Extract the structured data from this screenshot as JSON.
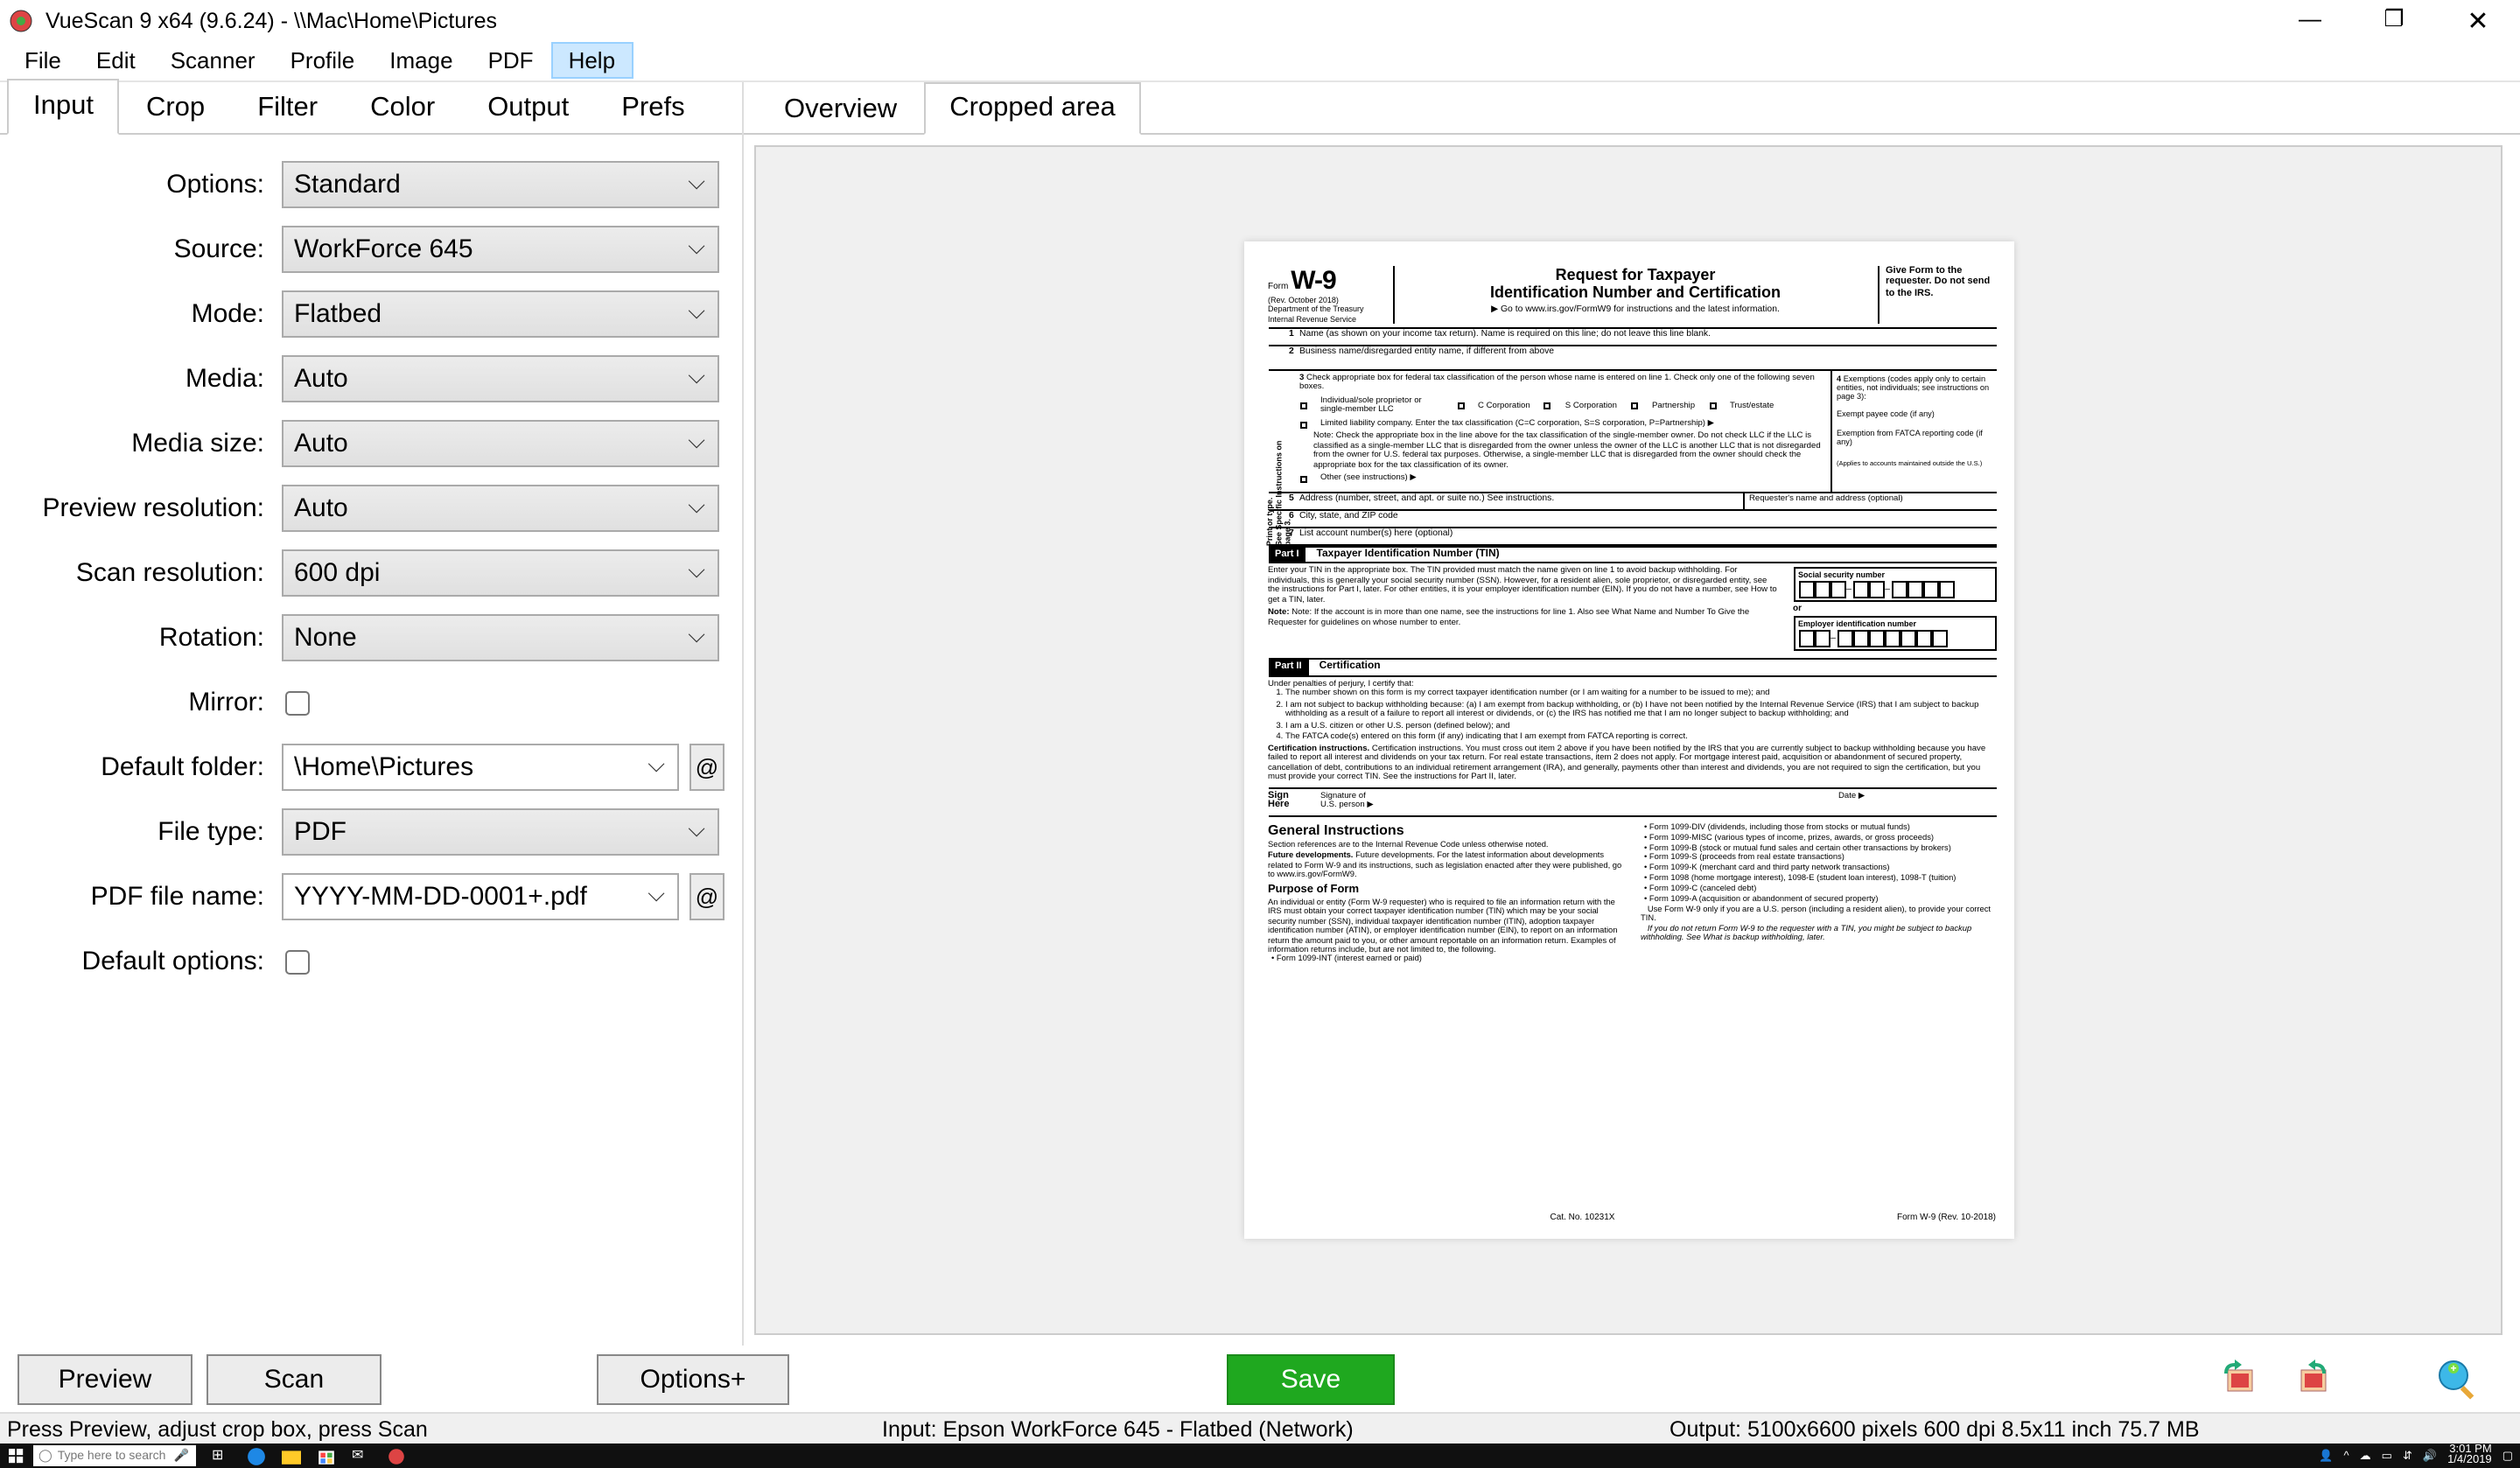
{
  "window": {
    "title": "VueScan 9 x64 (9.6.24)  -  \\\\Mac\\Home\\Pictures"
  },
  "menubar": {
    "items": [
      "File",
      "Edit",
      "Scanner",
      "Profile",
      "Image",
      "PDF",
      "Help"
    ],
    "active_index": 6
  },
  "left_tabs": {
    "items": [
      "Input",
      "Crop",
      "Filter",
      "Color",
      "Output",
      "Prefs"
    ],
    "active_index": 0
  },
  "right_tabs": {
    "items": [
      "Overview",
      "Cropped area"
    ],
    "active_index": 1
  },
  "form": {
    "options": {
      "label": "Options:",
      "value": "Standard"
    },
    "source": {
      "label": "Source:",
      "value": "WorkForce 645"
    },
    "mode": {
      "label": "Mode:",
      "value": "Flatbed"
    },
    "media": {
      "label": "Media:",
      "value": "Auto"
    },
    "media_size": {
      "label": "Media size:",
      "value": "Auto"
    },
    "preview_resolution": {
      "label": "Preview resolution:",
      "value": "Auto"
    },
    "scan_resolution": {
      "label": "Scan resolution:",
      "value": "600 dpi"
    },
    "rotation": {
      "label": "Rotation:",
      "value": "None"
    },
    "mirror": {
      "label": "Mirror:",
      "checked": false
    },
    "default_folder": {
      "label": "Default folder:",
      "value": "\\Home\\Pictures"
    },
    "file_type": {
      "label": "File type:",
      "value": "PDF"
    },
    "pdf_file_name": {
      "label": "PDF file name:",
      "value": "YYYY-MM-DD-0001+.pdf"
    },
    "default_options": {
      "label": "Default options:",
      "checked": false
    }
  },
  "buttons": {
    "preview": "Preview",
    "scan": "Scan",
    "options_plus": "Options+",
    "save": "Save"
  },
  "statusbar": {
    "left": "Press Preview, adjust crop box, press Scan",
    "mid": "Input: Epson WorkForce 645 - Flatbed (Network)",
    "right": "Output: 5100x6600 pixels 600 dpi 8.5x11 inch 75.7 MB"
  },
  "taskbar": {
    "search_placeholder": "Type here to search",
    "time": "3:01 PM",
    "date": "1/4/2019"
  },
  "document": {
    "form_code": "W-9",
    "form_prefix": "Form",
    "rev": "(Rev. October 2018)",
    "dept": "Department of the Treasury\nInternal Revenue Service",
    "title1": "Request for Taxpayer",
    "title2": "Identification Number and Certification",
    "title3": "▶ Go to www.irs.gov/FormW9 for instructions and the latest information.",
    "give_to": "Give Form to the requester. Do not send to the IRS.",
    "row1": "Name (as shown on your income tax return). Name is required on this line; do not leave this line blank.",
    "row2": "Business name/disregarded entity name, if different from above",
    "row3_intro": "Check appropriate box for federal tax classification of the person whose name is entered on line 1. Check only one of the following seven boxes.",
    "row3_checks": [
      "Individual/sole proprietor or single-member LLC",
      "C Corporation",
      "S Corporation",
      "Partnership",
      "Trust/estate"
    ],
    "row3_llc": "Limited liability company. Enter the tax classification (C=C corporation, S=S corporation, P=Partnership) ▶",
    "row3_note": "Note: Check the appropriate box in the line above for the tax classification of the single-member owner. Do not check LLC if the LLC is classified as a single-member LLC that is disregarded from the owner unless the owner of the LLC is another LLC that is not disregarded from the owner for U.S. federal tax purposes. Otherwise, a single-member LLC that is disregarded from the owner should check the appropriate box for the tax classification of its owner.",
    "row3_other": "Other (see instructions) ▶",
    "row4_title": "Exemptions (codes apply only to certain entities, not individuals; see instructions on page 3):",
    "row4_payee": "Exempt payee code (if any)",
    "row4_fatca": "Exemption from FATCA reporting code (if any)",
    "row4_foot": "(Applies to accounts maintained outside the U.S.)",
    "row5": "Address (number, street, and apt. or suite no.) See instructions.",
    "row5_right": "Requester's name and address (optional)",
    "row6": "City, state, and ZIP code",
    "row7": "List account number(s) here (optional)",
    "part1_label": "Part I",
    "part1_title": "Taxpayer Identification Number (TIN)",
    "part1_body1": "Enter your TIN in the appropriate box. The TIN provided must match the name given on line 1 to avoid backup withholding. For individuals, this is generally your social security number (SSN). However, for a resident alien, sole proprietor, or disregarded entity, see the instructions for Part I, later. For other entities, it is your employer identification number (EIN). If you do not have a number, see How to get a TIN, later.",
    "part1_body2": "Note: If the account is in more than one name, see the instructions for line 1. Also see What Name and Number To Give the Requester for guidelines on whose number to enter.",
    "ssn_label": "Social security number",
    "or_label": "or",
    "ein_label": "Employer identification number",
    "part2_label": "Part II",
    "part2_title": "Certification",
    "cert_intro": "Under penalties of perjury, I certify that:",
    "cert_items": [
      "The number shown on this form is my correct taxpayer identification number (or I am waiting for a number to be issued to me); and",
      "I am not subject to backup withholding because: (a) I am exempt from backup withholding, or (b) I have not been notified by the Internal Revenue Service (IRS) that I am subject to backup withholding as a result of a failure to report all interest or dividends, or (c) the IRS has notified me that I am no longer subject to backup withholding; and",
      "I am a U.S. citizen or other U.S. person (defined below); and",
      "The FATCA code(s) entered on this form (if any) indicating that I am exempt from FATCA reporting is correct."
    ],
    "cert_inst": "Certification instructions. You must cross out item 2 above if you have been notified by the IRS that you are currently subject to backup withholding because you have failed to report all interest and dividends on your tax return. For real estate transactions, item 2 does not apply. For mortgage interest paid, acquisition or abandonment of secured property, cancellation of debt, contributions to an individual retirement arrangement (IRA), and generally, payments other than interest and dividends, you are not required to sign the certification, but you must provide your correct TIN. See the instructions for Part II, later.",
    "sign_here": "Sign\nHere",
    "sig_label": "Signature of\nU.S. person ▶",
    "date_label": "Date ▶",
    "instr_heading": "General Instructions",
    "instr_sec_ref": "Section references are to the Internal Revenue Code unless otherwise noted.",
    "instr_future": "Future developments. For the latest information about developments related to Form W-9 and its instructions, such as legislation enacted after they were published, go to www.irs.gov/FormW9.",
    "purpose_heading": "Purpose of Form",
    "purpose_body": "An individual or entity (Form W-9 requester) who is required to file an information return with the IRS must obtain your correct taxpayer identification number (TIN) which may be your social security number (SSN), individual taxpayer identification number (ITIN), adoption taxpayer identification number (ATIN), or employer identification number (EIN), to report on an information return the amount paid to you, or other amount reportable on an information return. Examples of information returns include, but are not limited to, the following.",
    "purpose_bullet1": "• Form 1099-INT (interest earned or paid)",
    "col2_bullets": [
      "• Form 1099-DIV (dividends, including those from stocks or mutual funds)",
      "• Form 1099-MISC (various types of income, prizes, awards, or gross proceeds)",
      "• Form 1099-B (stock or mutual fund sales and certain other transactions by brokers)",
      "• Form 1099-S (proceeds from real estate transactions)",
      "• Form 1099-K (merchant card and third party network transactions)",
      "• Form 1098 (home mortgage interest), 1098-E (student loan interest), 1098-T (tuition)",
      "• Form 1099-C (canceled debt)",
      "• Form 1099-A (acquisition or abandonment of secured property)"
    ],
    "col2_use": "   Use Form W-9 only if you are a U.S. person (including a resident alien), to provide your correct TIN.",
    "col2_italic": "   If you do not return Form W-9 to the requester with a TIN, you might be subject to backup withholding. See What is backup withholding, later.",
    "footer_cat": "Cat. No. 10231X",
    "footer_form": "Form W-9 (Rev. 10-2018)"
  }
}
